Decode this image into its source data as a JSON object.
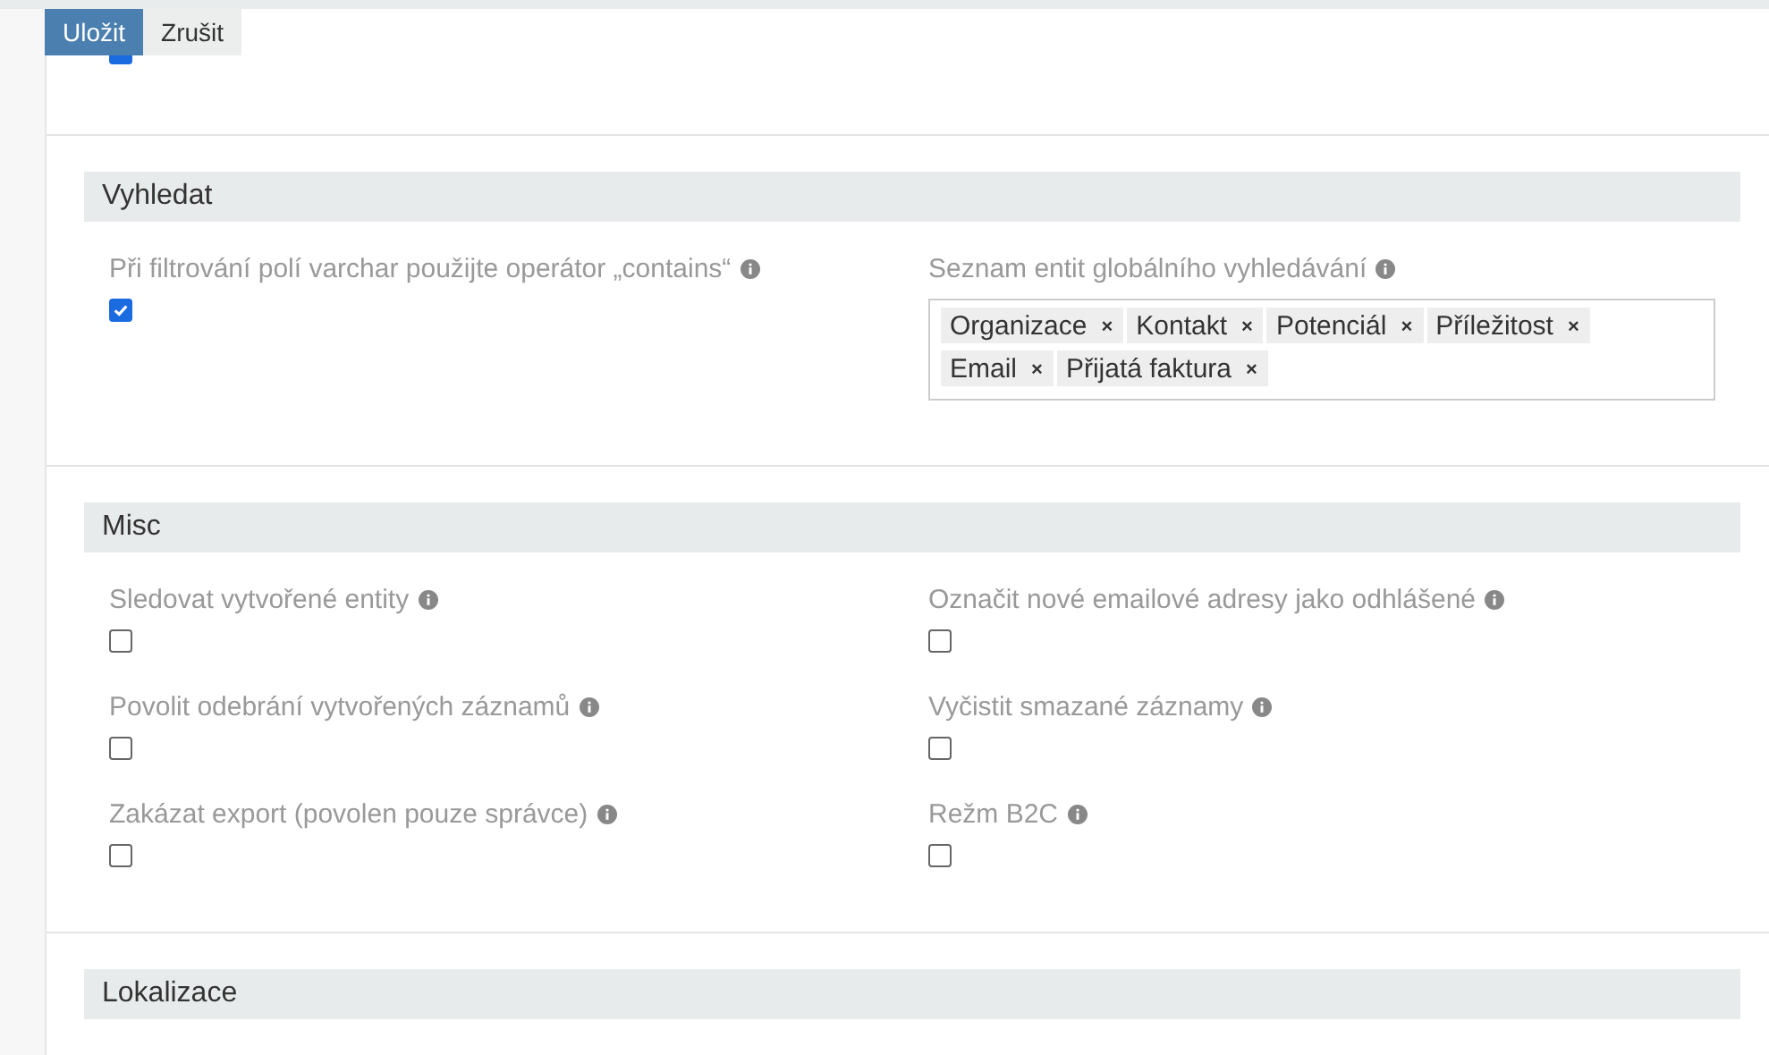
{
  "toolbar": {
    "buttons": [
      {
        "label": "Uložit",
        "kind": "primary"
      },
      {
        "label": "Zrušit",
        "kind": "default"
      }
    ]
  },
  "top_field": {
    "checked": true
  },
  "sections": [
    {
      "title": "Vyhledat",
      "fields": [
        {
          "kind": "checkbox",
          "label": "Při filtrování polí varchar použijte operátor „contains“",
          "checked": true
        },
        {
          "kind": "tags",
          "label": "Seznam entit globálního vyhledávání",
          "tags": [
            "Organizace",
            "Kontakt",
            "Potenciál",
            "Příležitost",
            "Email",
            "Přijatá faktura"
          ],
          "remove": "×"
        }
      ]
    },
    {
      "title": "Misc",
      "fields": [
        {
          "kind": "checkbox",
          "label": "Sledovat vytvořené entity",
          "checked": false
        },
        {
          "kind": "checkbox",
          "label": "Označit nové emailové adresy jako odhlášené",
          "checked": false
        },
        {
          "kind": "checkbox",
          "label": "Povolit odebrání vytvořených záznamů",
          "checked": false
        },
        {
          "kind": "checkbox",
          "label": "Vyčistit smazané záznamy",
          "checked": false
        },
        {
          "kind": "checkbox",
          "label": "Zakázat export (povolen pouze správce)",
          "checked": false
        },
        {
          "kind": "checkbox",
          "label": "Režm B2C",
          "checked": false
        }
      ]
    },
    {
      "title": "Lokalizace"
    }
  ]
}
